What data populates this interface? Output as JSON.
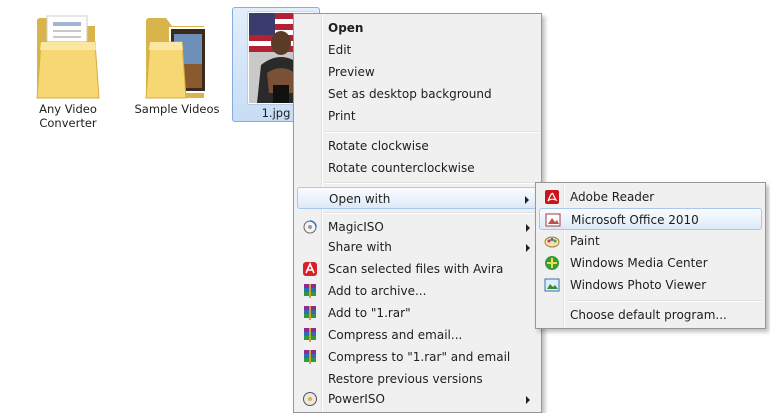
{
  "desktop": {
    "files": [
      {
        "label": "Any Video Converter",
        "icon": "folder-icon"
      },
      {
        "label": "Sample Videos",
        "icon": "folder-icon"
      },
      {
        "label": "1.jpg",
        "icon": "image-thumbnail-icon"
      }
    ]
  },
  "context_menu": {
    "items": [
      {
        "label": "Open"
      },
      {
        "label": "Edit"
      },
      {
        "label": "Preview"
      },
      {
        "label": "Set as desktop background"
      },
      {
        "label": "Print"
      },
      {
        "label": "Rotate clockwise"
      },
      {
        "label": "Rotate counterclockwise"
      },
      {
        "label": "Open with",
        "has_submenu": true
      },
      {
        "label": "MagicISO",
        "icon": "magiciso-icon",
        "has_submenu": true
      },
      {
        "label": "Share with",
        "has_submenu": true
      },
      {
        "label": "Scan selected files with Avira",
        "icon": "avira-icon"
      },
      {
        "label": "Add to archive...",
        "icon": "winrar-icon"
      },
      {
        "label": "Add to \"1.rar\"",
        "icon": "winrar-icon"
      },
      {
        "label": "Compress and email...",
        "icon": "winrar-icon"
      },
      {
        "label": "Compress to \"1.rar\" and email",
        "icon": "winrar-icon"
      },
      {
        "label": "Restore previous versions"
      },
      {
        "label": "PowerISO",
        "icon": "poweriso-icon",
        "has_submenu": true
      }
    ]
  },
  "open_with_menu": {
    "items": [
      {
        "label": "Adobe Reader",
        "icon": "adobe-reader-icon"
      },
      {
        "label": "Microsoft Office 2010",
        "icon": "office-picture-icon"
      },
      {
        "label": "Paint",
        "icon": "paint-icon"
      },
      {
        "label": "Windows Media Center",
        "icon": "media-center-icon"
      },
      {
        "label": "Windows Photo Viewer",
        "icon": "photo-viewer-icon"
      },
      {
        "label": "Choose default program..."
      }
    ]
  },
  "colors": {
    "highlight_border": "#a8c8ec",
    "selection_background": "#c7ddf6",
    "menu_background": "#f0f0f0"
  }
}
